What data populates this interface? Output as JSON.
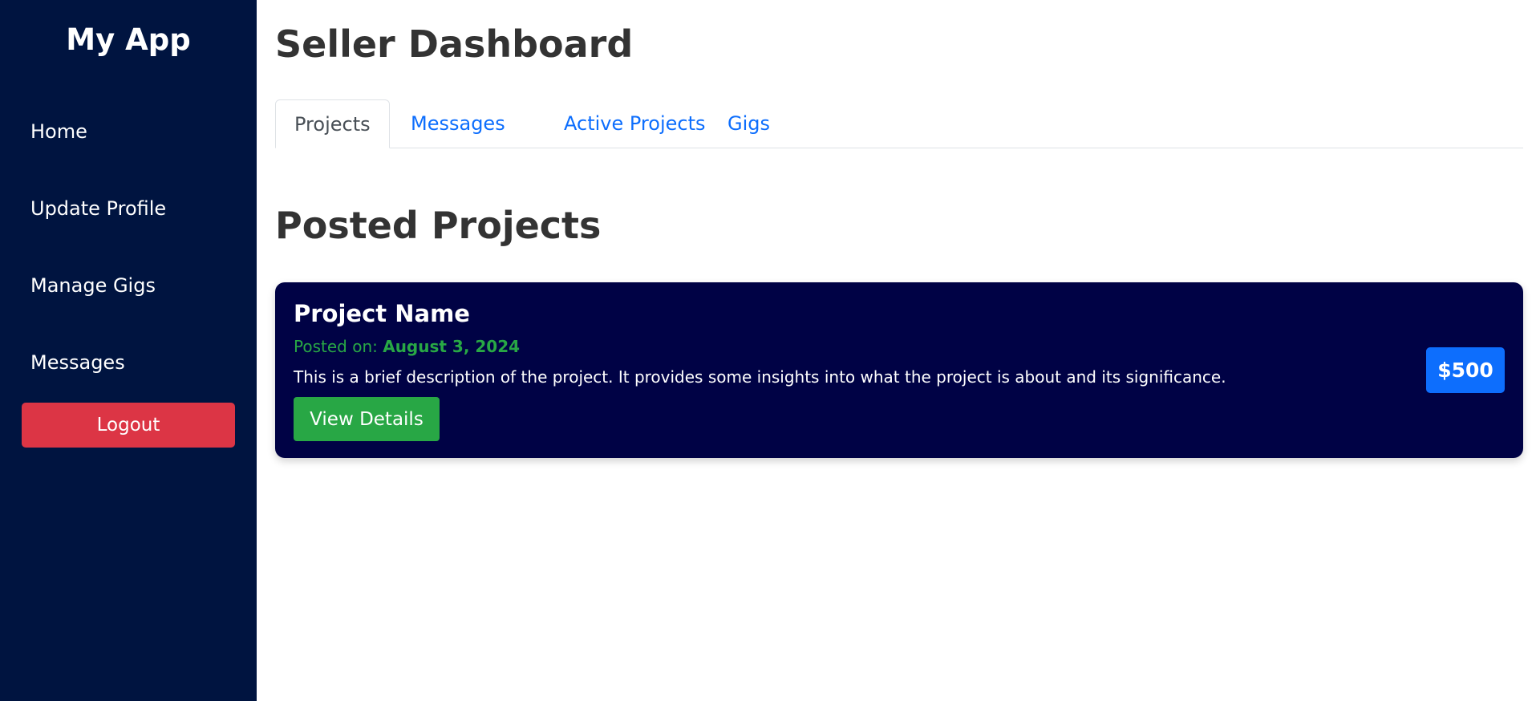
{
  "sidebar": {
    "brand": "My App",
    "items": [
      {
        "label": "Home"
      },
      {
        "label": "Update Profile"
      },
      {
        "label": "Manage Gigs"
      },
      {
        "label": "Messages"
      }
    ],
    "logout_label": "Logout"
  },
  "main": {
    "title": "Seller Dashboard",
    "tabs": [
      {
        "label": "Projects",
        "active": true
      },
      {
        "label": "Messages",
        "active": false
      },
      {
        "label": "Active Projects",
        "active": false
      },
      {
        "label": "Gigs",
        "active": false
      }
    ],
    "section_title": "Posted Projects",
    "projects": [
      {
        "name": "Project Name",
        "posted_prefix": "Posted on:",
        "posted_date": "August 3, 2024",
        "description": "This is a brief description of the project. It provides some insights into what the project is about and its significance.",
        "details_label": "View Details",
        "price": "$500"
      }
    ]
  },
  "colors": {
    "sidebar_bg": "#001440",
    "card_bg": "#000245",
    "logout": "#dc3545",
    "success": "#28a745",
    "primary": "#0d6efd",
    "heading": "#333333"
  }
}
